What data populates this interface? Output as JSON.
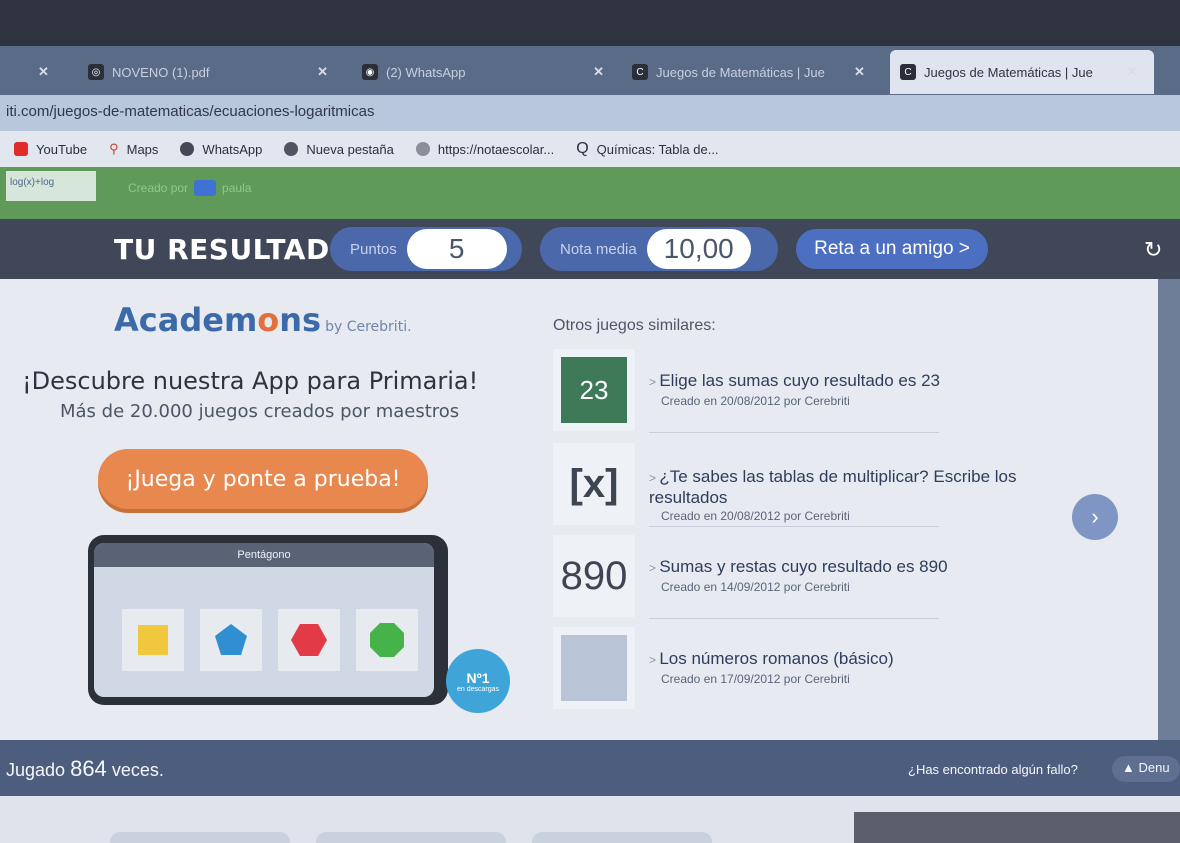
{
  "tabs": [
    {
      "title": "NOVENO (1).pdf"
    },
    {
      "title": "(2) WhatsApp"
    },
    {
      "title": "Juegos de Matemáticas | Jue"
    },
    {
      "title": "Juegos de Matemáticas | Jue"
    }
  ],
  "url": "iti.com/juegos-de-matematicas/ecuaciones-logaritmicas",
  "bookmarks": [
    "YouTube",
    "Maps",
    "WhatsApp",
    "Nueva pestaña",
    "https://notaescolar...",
    "Químicas: Tabla de..."
  ],
  "header": {
    "created_by": "Creado por",
    "author": "paula",
    "result_label": "TU RESULTADO:",
    "points_label": "Puntos",
    "points_value": "5",
    "avg_label": "Nota media",
    "avg_value": "10,00",
    "challenge_label": "Reta a un amigo >"
  },
  "promo": {
    "brand": "Academons",
    "brand_by": "by Cerebriti.",
    "headline": "¡Descubre nuestra App para Primaria!",
    "sub": "Más de 20.000 juegos creados por maestros",
    "cta": "¡Juega y ponte a prueba!",
    "phone_title": "Pentágono",
    "badge": "Nº1",
    "badge_small": "en descargas"
  },
  "similar": {
    "title": "Otros juegos similares:",
    "games": [
      {
        "thumb": "23",
        "title": "Elige las sumas cuyo resultado es 23",
        "meta": "Creado en 20/08/2012 por  Cerebriti"
      },
      {
        "thumb": "[x]",
        "title": "¿Te sabes las tablas de multiplicar? Escribe los resultados",
        "meta": "Creado en 20/08/2012 por  Cerebriti"
      },
      {
        "thumb": "890",
        "title": "Sumas y restas cuyo resultado es 890",
        "meta": "Creado en 14/09/2012 por  Cerebriti"
      },
      {
        "thumb": "",
        "title": "Los números romanos (básico)",
        "meta": "Creado en 17/09/2012 por  Cerebriti"
      }
    ]
  },
  "footer": {
    "played_prefix": "Jugado",
    "played_count": "864",
    "played_suffix": "veces.",
    "bug_question": "¿Has encontrado algún fallo?",
    "report": "Denu"
  },
  "colors": {
    "accent": "#4b68aa",
    "cta": "#e8874e",
    "green": "#5f9a58"
  }
}
